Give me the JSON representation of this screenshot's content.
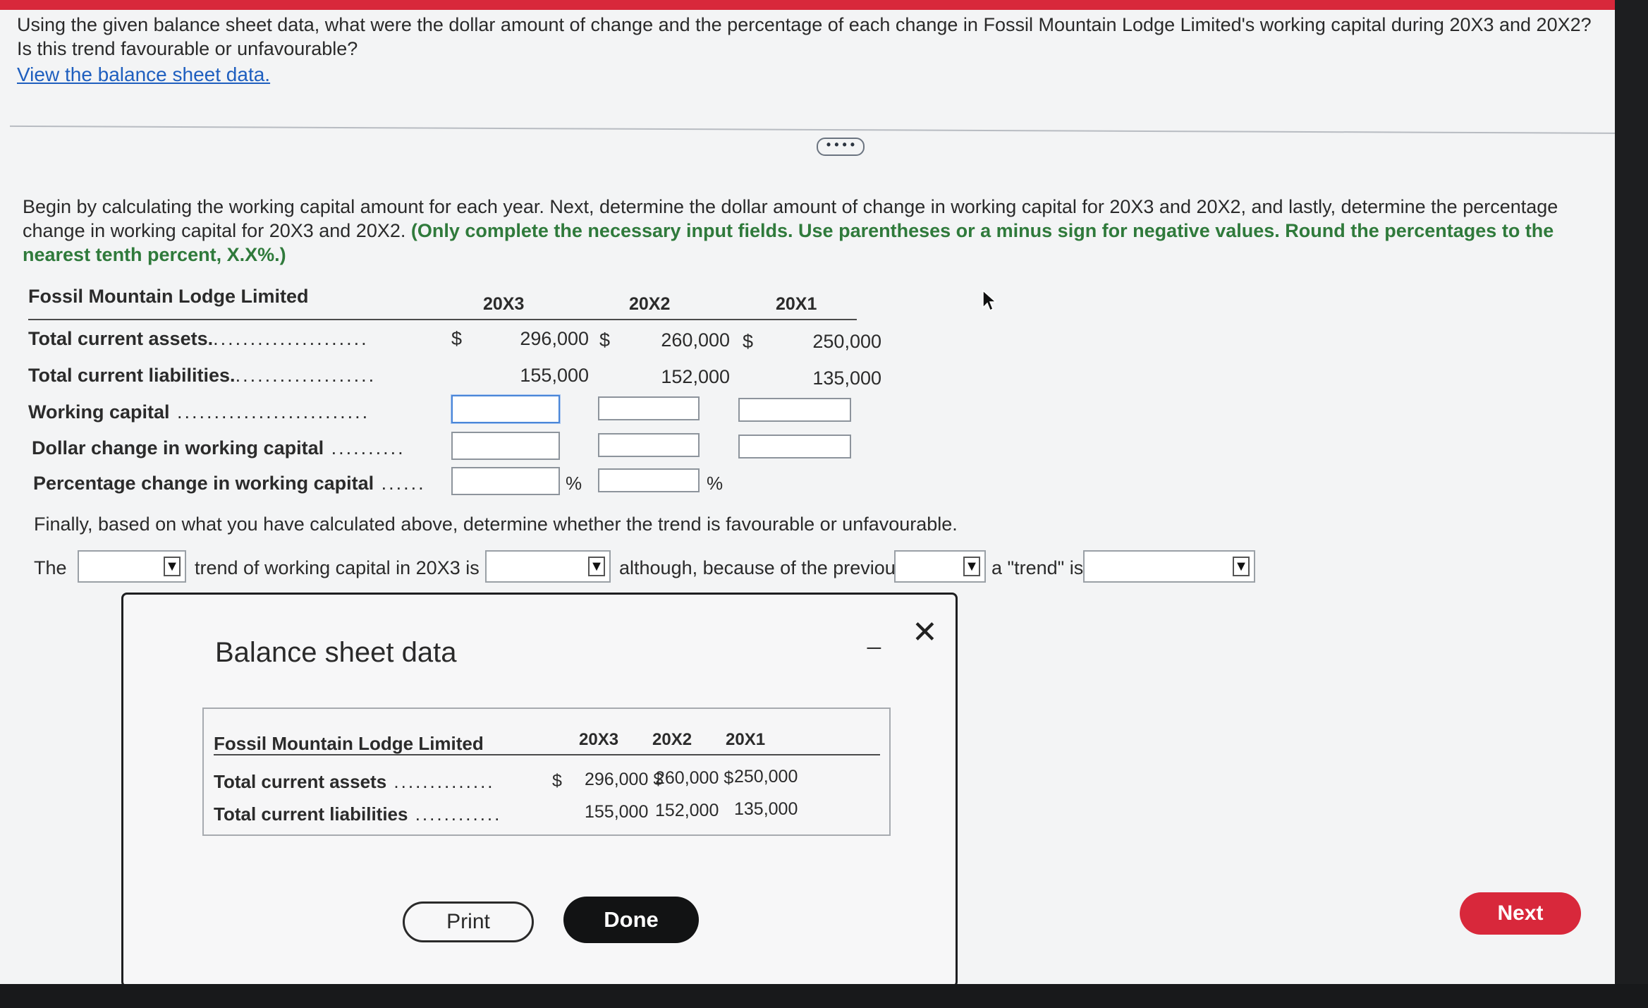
{
  "question": {
    "text": "Using the given balance sheet data, what were the dollar amount of change and the percentage of each change in Fossil Mountain Lodge Limited's working capital during 20X3 and 20X2? Is this trend favourable or unfavourable?",
    "link": "View the balance sheet data."
  },
  "instructions": {
    "text": "Begin by calculating the working capital amount for each year. Next, determine the dollar amount of change in working capital for 20X3 and 20X2, and lastly, determine the percentage change in working capital for 20X3 and 20X2.",
    "highlight": "(Only complete the necessary input fields. Use parentheses or a minus sign for negative values. Round the percentages to the nearest tenth percent, X.X%.)"
  },
  "main_table": {
    "company": "Fossil Mountain Lodge Limited",
    "years": [
      "20X3",
      "20X2",
      "20X1"
    ],
    "currency": "$",
    "percent": "%",
    "rows": {
      "total_current_assets": {
        "label": "Total current assets.",
        "values": [
          "296,000",
          "260,000",
          "250,000"
        ]
      },
      "total_current_liabilities": {
        "label": "Total current liabilities.",
        "values": [
          "155,000",
          "152,000",
          "135,000"
        ]
      },
      "working_capital": {
        "label": "Working capital"
      },
      "dollar_change": {
        "label": "Dollar change in working capital"
      },
      "percentage_change": {
        "label": "Percentage change in working capital"
      }
    }
  },
  "trend": {
    "finally": "Finally, based on what you have calculated above, determine whether the trend is favourable or unfavourable.",
    "the": "The",
    "mid1": "trend of working capital in 20X3 is",
    "mid2": "although, because of the previous",
    "mid3": "a \"trend\" is",
    "dropdown_arrow": "▼"
  },
  "modal": {
    "title": "Balance sheet data",
    "minimize": "_",
    "close": "✕",
    "company": "Fossil Mountain Lodge Limited",
    "years": [
      "20X3",
      "20X2",
      "20X1"
    ],
    "rows": [
      {
        "label": "Total current assets",
        "c1": "296,000 $",
        "c2": "260,000 $",
        "c3": "250,000"
      },
      {
        "label": "Total current liabilities",
        "c1": "155,000",
        "c2": "152,000",
        "c3": "135,000"
      }
    ],
    "dollar": "$",
    "print": "Print",
    "done": "Done"
  },
  "ellipsis": "• • • •",
  "next": "Next",
  "colors": {
    "accent_red": "#d8283b",
    "link_blue": "#1f5fbf",
    "highlight_green": "#2f7a3b"
  }
}
